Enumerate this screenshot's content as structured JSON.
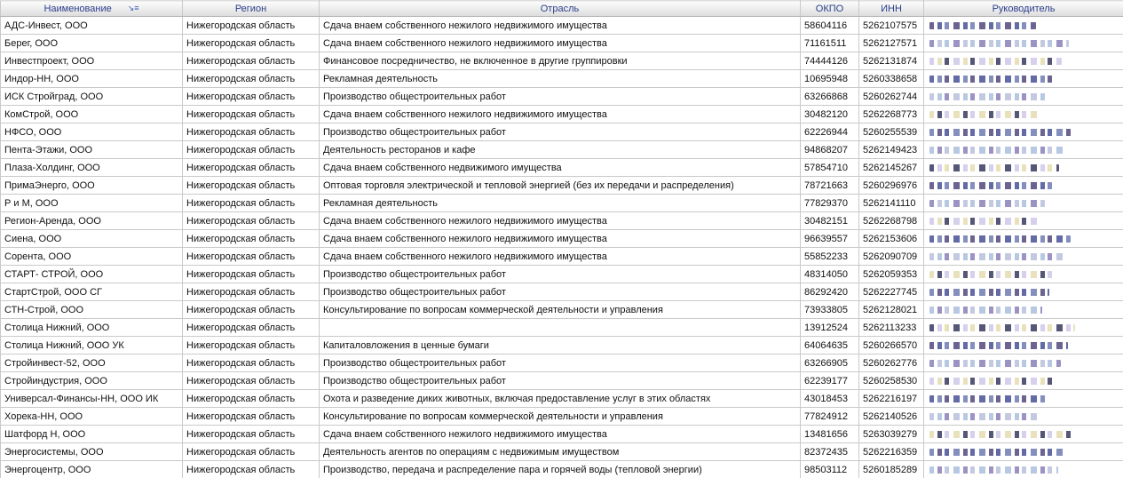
{
  "columns": {
    "name": "Наименование",
    "region": "Регион",
    "industry": "Отрасль",
    "okpo": "ОКПО",
    "inn": "ИНН",
    "director": "Руководитель"
  },
  "sort_icon": "sort-descending-icon",
  "rows": [
    {
      "name": "АДС-Инвест, ООО",
      "region": "Нижегородская область",
      "industry": "Сдача внаем собственного нежилого недвижимого имущества",
      "okpo": "58604116",
      "inn": "5262107575"
    },
    {
      "name": "Берег, ООО",
      "region": "Нижегородская область",
      "industry": "Сдача внаем собственного нежилого недвижимого имущества",
      "okpo": "71161511",
      "inn": "5262127571"
    },
    {
      "name": "Инвестпроект, ООО",
      "region": "Нижегородская область",
      "industry": "Финансовое посредничество, не включенное в другие группировки",
      "okpo": "74444126",
      "inn": "5262131874"
    },
    {
      "name": "Индор-НН, ООО",
      "region": "Нижегородская область",
      "industry": "Рекламная деятельность",
      "okpo": "10695948",
      "inn": "5260338658"
    },
    {
      "name": "ИСК Стройград, ООО",
      "region": "Нижегородская область",
      "industry": "Производство общестроительных работ",
      "okpo": "63266868",
      "inn": "5260262744"
    },
    {
      "name": "КомСтрой, ООО",
      "region": "Нижегородская область",
      "industry": "Сдача внаем собственного нежилого недвижимого имущества",
      "okpo": "30482120",
      "inn": "5262268773"
    },
    {
      "name": "НФСО, ООО",
      "region": "Нижегородская область",
      "industry": "Производство общестроительных работ",
      "okpo": "62226944",
      "inn": "5260255539"
    },
    {
      "name": "Пента-Этажи, ООО",
      "region": "Нижегородская область",
      "industry": "Деятельность ресторанов и кафе",
      "okpo": "94868207",
      "inn": "5262149423"
    },
    {
      "name": "Плаза-Холдинг, ООО",
      "region": "Нижегородская область",
      "industry": "Сдача внаем собственного недвижимого имущества",
      "okpo": "57854710",
      "inn": "5262145267"
    },
    {
      "name": "ПримаЭнерго, ООО",
      "region": "Нижегородская область",
      "industry": "Оптовая торговля электрической и тепловой энергией (без их передачи и распределения)",
      "okpo": "78721663",
      "inn": "5260296976"
    },
    {
      "name": "Р и М, ООО",
      "region": "Нижегородская область",
      "industry": "Рекламная деятельность",
      "okpo": "77829370",
      "inn": "5262141110"
    },
    {
      "name": "Регион-Аренда, ООО",
      "region": "Нижегородская область",
      "industry": "Сдача внаем собственного нежилого недвижимого имущества",
      "okpo": "30482151",
      "inn": "5262268798"
    },
    {
      "name": "Сиена, ООО",
      "region": "Нижегородская область",
      "industry": "Сдача внаем собственного нежилого недвижимого имущества",
      "okpo": "96639557",
      "inn": "5262153606"
    },
    {
      "name": "Сорента, ООО",
      "region": "Нижегородская область",
      "industry": "Сдача внаем собственного нежилого недвижимого имущества",
      "okpo": "55852233",
      "inn": "5262090709"
    },
    {
      "name": "СТАРТ- СТРОЙ, ООО",
      "region": "Нижегородская область",
      "industry": "Производство общестроительных работ",
      "okpo": "48314050",
      "inn": "5262059353"
    },
    {
      "name": "СтартСтрой, ООО СГ",
      "region": "Нижегородская область",
      "industry": "Производство общестроительных работ",
      "okpo": "86292420",
      "inn": "5262227745"
    },
    {
      "name": "СТН-Строй, ООО",
      "region": "Нижегородская область",
      "industry": "Консультирование по вопросам коммерческой деятельности и управления",
      "okpo": "73933805",
      "inn": "5262128021"
    },
    {
      "name": "Столица Нижний, ООО",
      "region": "Нижегородская область",
      "industry": "",
      "okpo": "13912524",
      "inn": "5262113233"
    },
    {
      "name": "Столица Нижний, ООО УК",
      "region": "Нижегородская область",
      "industry": "Капиталовложения в ценные бумаги",
      "okpo": "64064635",
      "inn": "5260266570"
    },
    {
      "name": "Стройинвест-52, ООО",
      "region": "Нижегородская область",
      "industry": "Производство общестроительных работ",
      "okpo": "63266905",
      "inn": "5260262776"
    },
    {
      "name": "Стройиндустрия, ООО",
      "region": "Нижегородская область",
      "industry": "Производство общестроительных работ",
      "okpo": "62239177",
      "inn": "5260258530"
    },
    {
      "name": "Универсал-Финансы-НН, ООО ИК",
      "region": "Нижегородская область",
      "industry": "Охота и разведение диких животных, включая предоставление услуг в этих областях",
      "okpo": "43018453",
      "inn": "5262216197"
    },
    {
      "name": "Хорека-НН, ООО",
      "region": "Нижегородская область",
      "industry": "Консультирование по вопросам коммерческой деятельности и управления",
      "okpo": "77824912",
      "inn": "5262140526"
    },
    {
      "name": "Шатфорд Н, ООО",
      "region": "Нижегородская область",
      "industry": "Сдача внаем собственного нежилого недвижимого имущества",
      "okpo": "13481656",
      "inn": "5263039279"
    },
    {
      "name": "Энергосистемы, ООО",
      "region": "Нижегородская область",
      "industry": "Деятельность агентов по операциям с недвижимым имуществом",
      "okpo": "82372435",
      "inn": "5262216359"
    },
    {
      "name": "Энергоцентр, ООО",
      "region": "Нижегородская область",
      "industry": "Производство, передача и распределение пара и горячей воды (тепловой энергии)",
      "okpo": "98503112",
      "inn": "5260185289"
    }
  ]
}
